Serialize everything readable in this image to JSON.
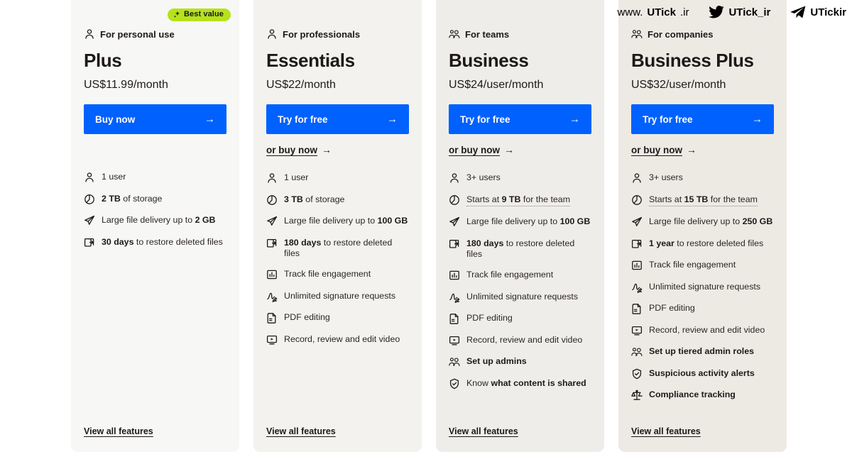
{
  "watermark": {
    "site_prefix": "www.",
    "site_brand": "UTick",
    "site_suffix": ".ir",
    "twitter_handle": "UTick_ir",
    "telegram_handle": "UTickir"
  },
  "colors": {
    "cta_blue": "#0061fe",
    "badge_green": "#b6e21c",
    "text_dark": "#1e1919"
  },
  "plans": [
    {
      "badge": "Best value",
      "badge_icon": "sparkle-icon",
      "audience": "For personal use",
      "audience_icon": "single-user-icon",
      "name": "Plus",
      "price": "US$11.99/month",
      "cta_label": "Buy now",
      "cta_arrow": "→",
      "secondary_label": "",
      "secondary_arrow": "→",
      "has_secondary": false,
      "view_all_label": "View all features",
      "features": [
        {
          "icon": "single-user-icon",
          "pre": "",
          "bold": "",
          "post": "1 user",
          "tooltip": false
        },
        {
          "icon": "storage-pie-icon",
          "pre": "",
          "bold": "2 TB",
          "post": " of storage",
          "tooltip": false
        },
        {
          "icon": "paper-plane-icon",
          "pre": "Large file delivery up to ",
          "bold": "2 GB",
          "post": "",
          "tooltip": false
        },
        {
          "icon": "restore-files-icon",
          "pre": "",
          "bold": "30 days",
          "post": " to restore deleted files",
          "tooltip": false
        }
      ]
    },
    {
      "badge": "",
      "badge_icon": "",
      "audience": "For professionals",
      "audience_icon": "single-user-icon",
      "name": "Essentials",
      "price": "US$22/month",
      "cta_label": "Try for free",
      "cta_arrow": "→",
      "secondary_label": "or buy now",
      "secondary_arrow": "→",
      "has_secondary": true,
      "view_all_label": "View all features",
      "features": [
        {
          "icon": "single-user-icon",
          "pre": "",
          "bold": "",
          "post": "1 user",
          "tooltip": false
        },
        {
          "icon": "storage-pie-icon",
          "pre": "",
          "bold": "3 TB",
          "post": " of storage",
          "tooltip": false
        },
        {
          "icon": "paper-plane-icon",
          "pre": "Large file delivery up to ",
          "bold": "100 GB",
          "post": "",
          "tooltip": false
        },
        {
          "icon": "restore-files-icon",
          "pre": "",
          "bold": "180 days",
          "post": " to restore deleted files",
          "tooltip": false
        },
        {
          "icon": "chart-engagement-icon",
          "pre": "Track file engagement",
          "bold": "",
          "post": "",
          "tooltip": false
        },
        {
          "icon": "signature-icon",
          "pre": "Unlimited signature requests",
          "bold": "",
          "post": "",
          "tooltip": false
        },
        {
          "icon": "pdf-edit-icon",
          "pre": "PDF editing",
          "bold": "",
          "post": "",
          "tooltip": false
        },
        {
          "icon": "video-record-icon",
          "pre": "Record, review and edit video",
          "bold": "",
          "post": "",
          "tooltip": false
        }
      ]
    },
    {
      "badge": "",
      "badge_icon": "",
      "audience": "For teams",
      "audience_icon": "multi-user-icon",
      "name": "Business",
      "price": "US$24/user/month",
      "cta_label": "Try for free",
      "cta_arrow": "→",
      "secondary_label": "or buy now",
      "secondary_arrow": "→",
      "has_secondary": true,
      "view_all_label": "View all features",
      "features": [
        {
          "icon": "single-user-icon",
          "pre": "",
          "bold": "",
          "post": "3+ users",
          "tooltip": false
        },
        {
          "icon": "storage-pie-icon",
          "pre": "Starts at ",
          "bold": "9 TB",
          "post": " for the team",
          "tooltip": true
        },
        {
          "icon": "paper-plane-icon",
          "pre": "Large file delivery up to ",
          "bold": "100 GB",
          "post": "",
          "tooltip": false
        },
        {
          "icon": "restore-files-icon",
          "pre": "",
          "bold": "180 days",
          "post": " to restore deleted files",
          "tooltip": false
        },
        {
          "icon": "chart-engagement-icon",
          "pre": "Track file engagement",
          "bold": "",
          "post": "",
          "tooltip": false
        },
        {
          "icon": "signature-icon",
          "pre": "Unlimited signature requests",
          "bold": "",
          "post": "",
          "tooltip": false
        },
        {
          "icon": "pdf-edit-icon",
          "pre": "PDF editing",
          "bold": "",
          "post": "",
          "tooltip": false
        },
        {
          "icon": "video-record-icon",
          "pre": "Record, review and edit video",
          "bold": "",
          "post": "",
          "tooltip": false
        },
        {
          "icon": "multi-user-icon",
          "pre": "",
          "bold": "Set up admins",
          "post": "",
          "tooltip": false
        },
        {
          "icon": "shield-check-icon",
          "pre": "Know ",
          "bold": "what content is shared",
          "post": "",
          "tooltip": false
        }
      ]
    },
    {
      "badge": "",
      "badge_icon": "",
      "audience": "For companies",
      "audience_icon": "multi-user-icon",
      "name": "Business Plus",
      "price": "US$32/user/month",
      "cta_label": "Try for free",
      "cta_arrow": "→",
      "secondary_label": "or buy now",
      "secondary_arrow": "→",
      "has_secondary": true,
      "view_all_label": "View all features",
      "features": [
        {
          "icon": "single-user-icon",
          "pre": "",
          "bold": "",
          "post": "3+ users",
          "tooltip": false
        },
        {
          "icon": "storage-pie-icon",
          "pre": "Starts at ",
          "bold": "15 TB",
          "post": " for the team",
          "tooltip": true
        },
        {
          "icon": "paper-plane-icon",
          "pre": "Large file delivery up to ",
          "bold": "250 GB",
          "post": "",
          "tooltip": false
        },
        {
          "icon": "restore-files-icon",
          "pre": "",
          "bold": "1 year",
          "post": " to restore deleted files",
          "tooltip": false
        },
        {
          "icon": "chart-engagement-icon",
          "pre": "Track file engagement",
          "bold": "",
          "post": "",
          "tooltip": false
        },
        {
          "icon": "signature-icon",
          "pre": "Unlimited signature requests",
          "bold": "",
          "post": "",
          "tooltip": false
        },
        {
          "icon": "pdf-edit-icon",
          "pre": "PDF editing",
          "bold": "",
          "post": "",
          "tooltip": false
        },
        {
          "icon": "video-record-icon",
          "pre": "Record, review and edit video",
          "bold": "",
          "post": "",
          "tooltip": false
        },
        {
          "icon": "multi-user-icon",
          "pre": "",
          "bold": "Set up tiered admin roles",
          "post": "",
          "tooltip": false
        },
        {
          "icon": "shield-check-icon",
          "pre": "",
          "bold": "Suspicious activity alerts",
          "post": "",
          "tooltip": false
        },
        {
          "icon": "scales-icon",
          "pre": "",
          "bold": "Compliance tracking",
          "post": "",
          "tooltip": false
        }
      ]
    }
  ]
}
